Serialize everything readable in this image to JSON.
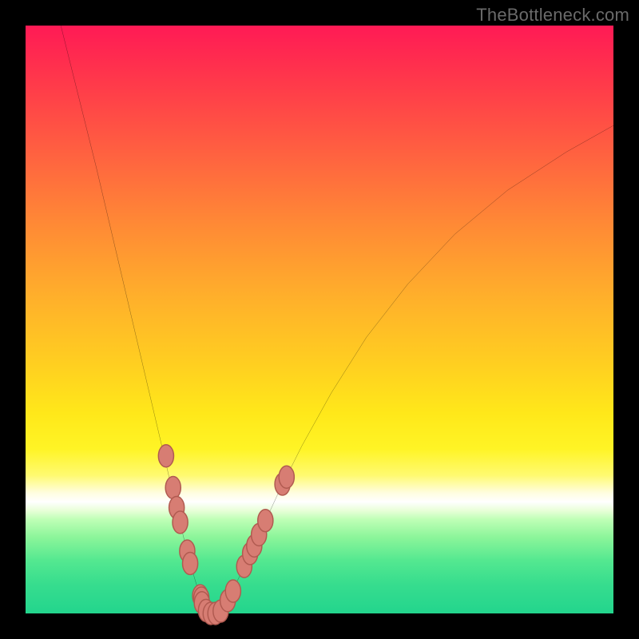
{
  "watermark": "TheBottleneck.com",
  "chart_data": {
    "type": "line",
    "title": "",
    "xlabel": "",
    "ylabel": "",
    "xlim": [
      0,
      100
    ],
    "ylim": [
      0,
      100
    ],
    "grid": false,
    "legend": false,
    "curve_x": [
      6,
      8,
      10,
      12,
      14,
      16,
      18,
      20,
      22,
      24,
      25.5,
      27,
      28.3,
      29.5,
      30.5,
      31.3,
      32,
      33,
      34,
      35.5,
      37.5,
      40,
      43,
      47,
      52,
      58,
      65,
      73,
      82,
      92,
      100
    ],
    "curve_y": [
      100,
      92,
      84,
      76,
      67.5,
      59,
      50.5,
      42,
      33.5,
      25,
      18.5,
      12.5,
      7.5,
      3.5,
      1,
      0,
      0,
      0.5,
      2,
      4.5,
      8.5,
      14,
      20.5,
      28.5,
      37.5,
      47,
      56,
      64.5,
      72,
      78.5,
      83
    ],
    "markers": [
      {
        "x": 23.9,
        "y": 26.8
      },
      {
        "x": 25.1,
        "y": 21.4
      },
      {
        "x": 25.7,
        "y": 18.0
      },
      {
        "x": 26.3,
        "y": 15.5
      },
      {
        "x": 27.5,
        "y": 10.6
      },
      {
        "x": 28.0,
        "y": 8.5
      },
      {
        "x": 29.7,
        "y": 3.0
      },
      {
        "x": 29.9,
        "y": 2.6
      },
      {
        "x": 30.0,
        "y": 1.8
      },
      {
        "x": 30.7,
        "y": 0.5
      },
      {
        "x": 31.5,
        "y": 0.0
      },
      {
        "x": 32.3,
        "y": 0.0
      },
      {
        "x": 33.2,
        "y": 0.4
      },
      {
        "x": 34.4,
        "y": 2.2
      },
      {
        "x": 35.3,
        "y": 3.8
      },
      {
        "x": 37.2,
        "y": 8.0
      },
      {
        "x": 38.2,
        "y": 10.2
      },
      {
        "x": 38.9,
        "y": 11.5
      },
      {
        "x": 39.7,
        "y": 13.4
      },
      {
        "x": 40.8,
        "y": 15.8
      },
      {
        "x": 43.7,
        "y": 22.0
      },
      {
        "x": 44.4,
        "y": 23.2
      }
    ],
    "marker_rx": 1.3,
    "marker_ry": 1.9,
    "background": "rainbow-vertical-gradient"
  }
}
